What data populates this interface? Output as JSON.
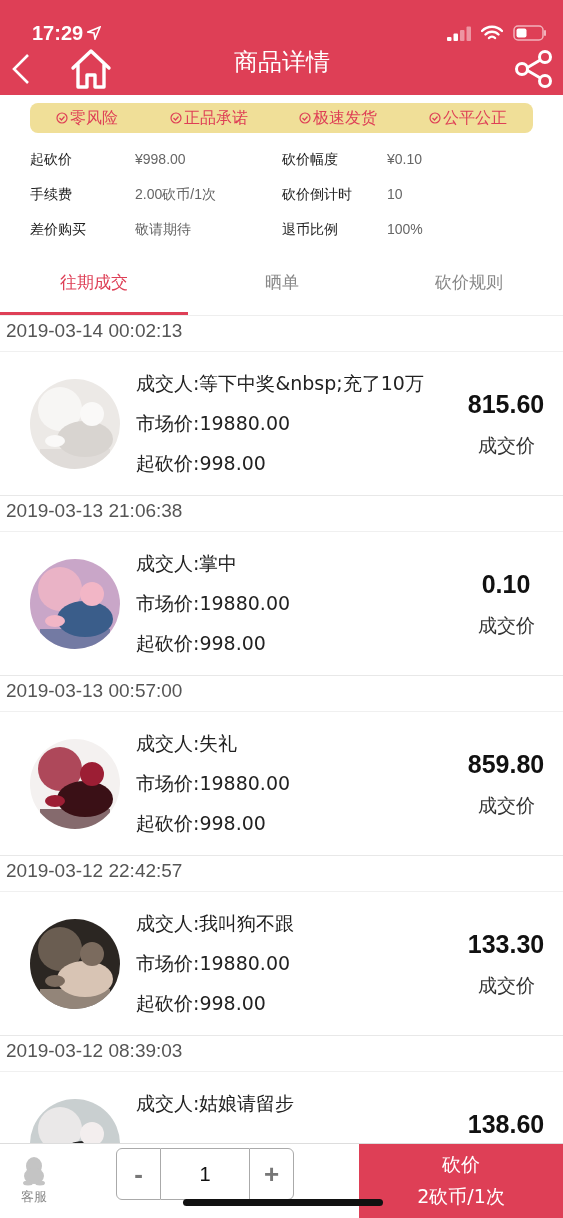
{
  "status_bar": {
    "time": "17:29"
  },
  "header": {
    "title": "商品详情"
  },
  "badges": [
    "零风险",
    "正品承诺",
    "极速发货",
    "公平公正"
  ],
  "info": [
    {
      "label": "起砍价",
      "value": "¥998.00"
    },
    {
      "label": "砍价幅度",
      "value": "¥0.10"
    },
    {
      "label": "手续费",
      "value": "2.00砍币/1次"
    },
    {
      "label": "砍价倒计时",
      "value": "10"
    },
    {
      "label": "差价购买",
      "value": "敬请期待"
    },
    {
      "label": "退币比例",
      "value": "100%"
    }
  ],
  "tabs": [
    {
      "label": "往期成交",
      "selected": true
    },
    {
      "label": "晒单",
      "selected": false
    },
    {
      "label": "砍价规则",
      "selected": false
    }
  ],
  "records": [
    {
      "date": "2019-03-14 00:02:13",
      "buyer": "成交人:等下中奖&nbsp;充了10万",
      "market": "市场价:19880.00",
      "start": "起砍价:998.00",
      "price": "815.60",
      "price_label": "成交价"
    },
    {
      "date": "2019-03-13 21:06:38",
      "buyer": "成交人:掌中",
      "market": "市场价:19880.00",
      "start": "起砍价:998.00",
      "price": "0.10",
      "price_label": "成交价"
    },
    {
      "date": "2019-03-13 00:57:00",
      "buyer": "成交人:失礼",
      "market": "市场价:19880.00",
      "start": "起砍价:998.00",
      "price": "859.80",
      "price_label": "成交价"
    },
    {
      "date": "2019-03-12 22:42:57",
      "buyer": "成交人:我叫狗不跟",
      "market": "市场价:19880.00",
      "start": "起砍价:998.00",
      "price": "133.30",
      "price_label": "成交价"
    },
    {
      "date": "2019-03-12 08:39:03",
      "buyer": "成交人:姑娘请留步",
      "price": "138.60"
    }
  ],
  "bottom_bar": {
    "service_label": "客服",
    "minus": "-",
    "quantity": "1",
    "plus": "+",
    "action_title": "砍价",
    "action_subtitle": "2砍币/1次"
  }
}
